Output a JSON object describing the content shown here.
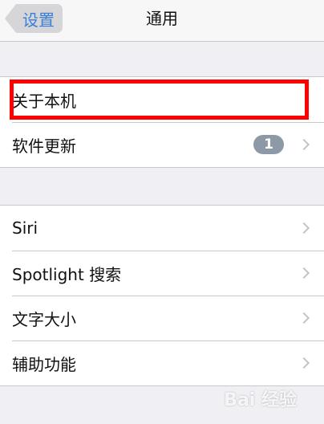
{
  "navbar": {
    "back_label": "设置",
    "title": "通用"
  },
  "group1": {
    "items": [
      {
        "label": "关于本机"
      },
      {
        "label": "软件更新",
        "badge": "1"
      }
    ]
  },
  "group2": {
    "items": [
      {
        "label": "Siri"
      },
      {
        "label": "Spotlight 搜索"
      },
      {
        "label": "文字大小"
      },
      {
        "label": "辅助功能"
      }
    ]
  },
  "colors": {
    "accent": "#3a7fd6",
    "highlight": "#ff0000",
    "badge": "#8e99a8",
    "background": "#efeff4"
  },
  "watermark": "Bai 经验"
}
